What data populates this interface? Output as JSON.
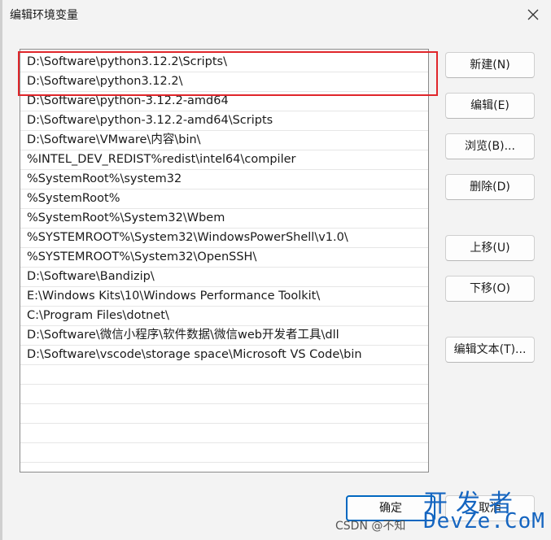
{
  "window": {
    "title": "编辑环境变量",
    "close_icon": "close-icon"
  },
  "path_list": [
    "D:\\Software\\python3.12.2\\Scripts\\",
    "D:\\Software\\python3.12.2\\",
    "D:\\Software\\python-3.12.2-amd64",
    "D:\\Software\\python-3.12.2-amd64\\Scripts",
    "D:\\Software\\VMware\\内容\\bin\\",
    "%INTEL_DEV_REDIST%redist\\intel64\\compiler",
    "%SystemRoot%\\system32",
    "%SystemRoot%",
    "%SystemRoot%\\System32\\Wbem",
    "%SYSTEMROOT%\\System32\\WindowsPowerShell\\v1.0\\",
    "%SYSTEMROOT%\\System32\\OpenSSH\\",
    "D:\\Software\\Bandizip\\",
    "E:\\Windows Kits\\10\\Windows Performance Toolkit\\",
    "C:\\Program Files\\dotnet\\",
    "D:\\Software\\微信小程序\\软件数据\\微信web开发者工具\\dll",
    "D:\\Software\\vscode\\storage space\\Microsoft VS Code\\bin",
    "",
    "",
    "",
    "",
    "",
    ""
  ],
  "buttons": {
    "new": "新建(N)",
    "edit": "编辑(E)",
    "browse": "浏览(B)...",
    "delete": "删除(D)",
    "move_up": "上移(U)",
    "move_down": "下移(O)",
    "edit_text": "编辑文本(T)...",
    "ok": "确定",
    "cancel": "取消"
  },
  "watermark": {
    "csdn": "CSDN @不知",
    "brand_top": "开发者",
    "brand_bottom": "DevZe.CoM"
  },
  "colors": {
    "highlight_border": "#e0262b",
    "ok_border": "#0067c0",
    "watermark": "#1565c0"
  }
}
